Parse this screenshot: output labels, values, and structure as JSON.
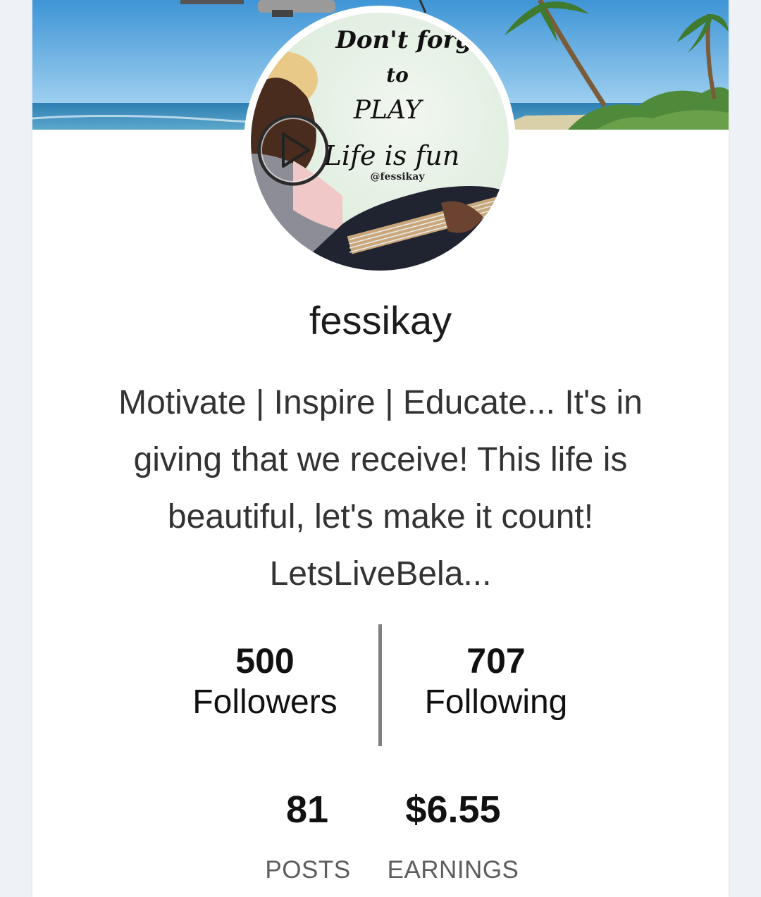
{
  "profile": {
    "avatar_text": {
      "line1": "Don't forget",
      "line2": "to",
      "line3": "PLAY",
      "line4": "Life is fun",
      "handle": "@fessikay"
    },
    "username": "fessikay",
    "bio_lines": [
      "Motivate | Inspire | Educate... It's in",
      "giving that we receive! This life is",
      "beautiful, let's make it count!",
      "LetsLiveBela..."
    ]
  },
  "stats": {
    "followers": {
      "value": "500",
      "label": "Followers"
    },
    "following": {
      "value": "707",
      "label": "Following"
    },
    "posts": {
      "value": "81",
      "label": "POSTS"
    },
    "earnings": {
      "value": "$6.55",
      "label": "EARNINGS"
    }
  },
  "icons": {
    "play": "play-icon"
  },
  "colors": {
    "background": "#eef1f5",
    "card": "#ffffff",
    "divider": "#7f7f7f",
    "sky": "#5aa7dc",
    "sea": "#2f7fae"
  }
}
